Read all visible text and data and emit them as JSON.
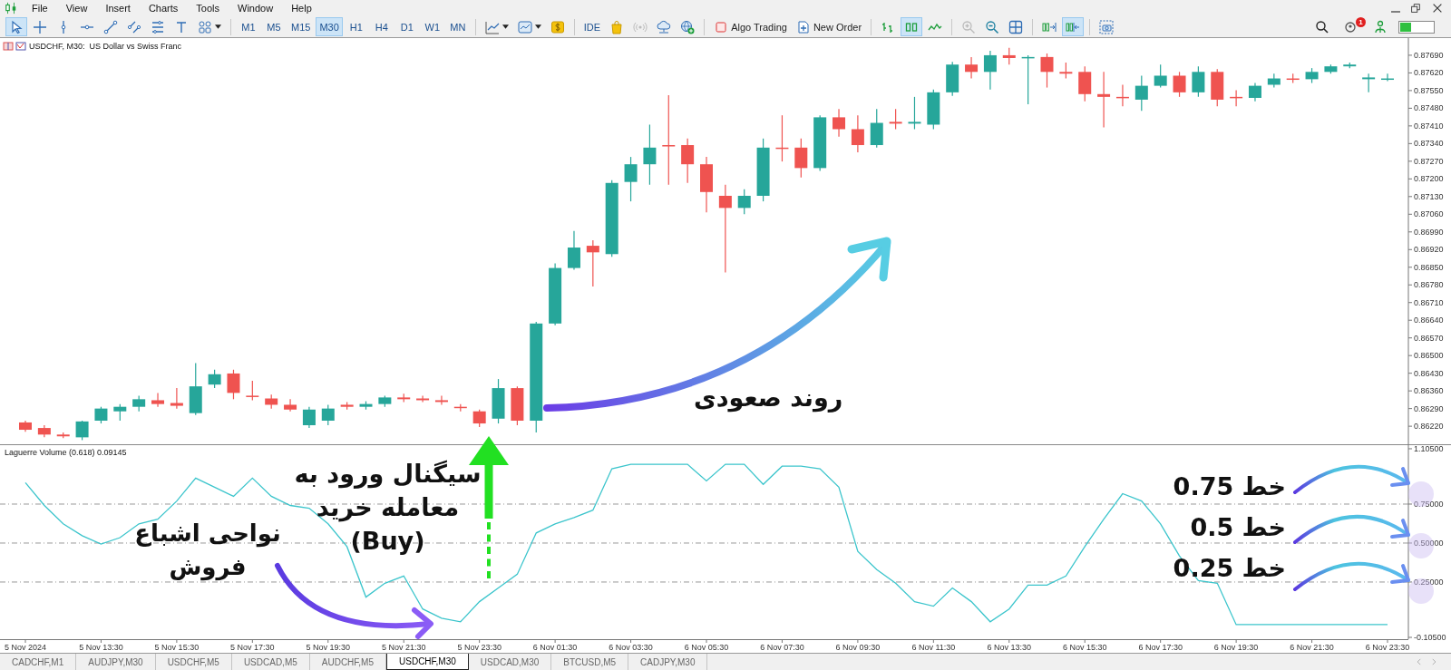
{
  "menu_bar": {
    "items": [
      "File",
      "View",
      "Insert",
      "Charts",
      "Tools",
      "Window",
      "Help"
    ]
  },
  "toolbar": {
    "drawing_tools": [
      {
        "kind": "cursor",
        "selected": true
      },
      {
        "kind": "crosshair",
        "selected": false
      },
      {
        "kind": "vertical-line",
        "selected": false
      },
      {
        "kind": "horizontal-line",
        "selected": false
      },
      {
        "kind": "trend-line",
        "selected": false
      },
      {
        "kind": "channel",
        "selected": false
      },
      {
        "kind": "fibonacci",
        "selected": false
      },
      {
        "kind": "text",
        "selected": false
      },
      {
        "kind": "shapes",
        "selected": false
      }
    ],
    "timeframes": [
      {
        "label": "M1",
        "selected": false
      },
      {
        "label": "M5",
        "selected": false
      },
      {
        "label": "M15",
        "selected": false
      },
      {
        "label": "M30",
        "selected": true
      },
      {
        "label": "H1",
        "selected": false
      },
      {
        "label": "H4",
        "selected": false
      },
      {
        "label": "D1",
        "selected": false
      },
      {
        "label": "W1",
        "selected": false
      },
      {
        "label": "MN",
        "selected": false
      }
    ],
    "ide_button": "IDE",
    "algo_trading_button": "Algo Trading",
    "new_order_button": "New Order",
    "chart_types": [
      {
        "kind": "bars",
        "selected": false
      },
      {
        "kind": "candles",
        "selected": true
      },
      {
        "kind": "line",
        "selected": false
      }
    ],
    "zoom_in": {
      "disabled": true
    },
    "scroll_tools": [
      {
        "kind": "autoscroll",
        "selected": false
      },
      {
        "kind": "chart-shift",
        "selected": true
      }
    ],
    "notification_count": "1"
  },
  "price_chart": {
    "chart_data": {
      "type": "candlestick",
      "title": "USDCHF, M30:  US Dollar vs Swiss Franc",
      "ylim": [
        0.86145,
        0.87758
      ],
      "yticks": [
        {
          "value": 0.8769,
          "label": "0.87690"
        },
        {
          "value": 0.8762,
          "label": "0.87620"
        },
        {
          "value": 0.8755,
          "label": "0.87550"
        },
        {
          "value": 0.8748,
          "label": "0.87480"
        },
        {
          "value": 0.8741,
          "label": "0.87410"
        },
        {
          "value": 0.8734,
          "label": "0.87340"
        },
        {
          "value": 0.8727,
          "label": "0.87270"
        },
        {
          "value": 0.872,
          "label": "0.87200"
        },
        {
          "value": 0.8713,
          "label": "0.87130"
        },
        {
          "value": 0.8706,
          "label": "0.87060"
        },
        {
          "value": 0.8699,
          "label": "0.86990"
        },
        {
          "value": 0.8692,
          "label": "0.86920"
        },
        {
          "value": 0.8685,
          "label": "0.86850"
        },
        {
          "value": 0.8678,
          "label": "0.86780"
        },
        {
          "value": 0.8671,
          "label": "0.86710"
        },
        {
          "value": 0.8664,
          "label": "0.86640"
        },
        {
          "value": 0.8657,
          "label": "0.86570"
        },
        {
          "value": 0.865,
          "label": "0.86500"
        },
        {
          "value": 0.8643,
          "label": "0.86430"
        },
        {
          "value": 0.8636,
          "label": "0.86360"
        },
        {
          "value": 0.8629,
          "label": "0.86290"
        },
        {
          "value": 0.8622,
          "label": "0.86220"
        }
      ],
      "ohlc": [
        [
          0.86235,
          0.86242,
          0.86198,
          0.86206
        ],
        [
          0.86213,
          0.86224,
          0.86176,
          0.86187
        ],
        [
          0.86187,
          0.86195,
          0.86173,
          0.8618
        ],
        [
          0.86176,
          0.86242,
          0.86165,
          0.86239
        ],
        [
          0.86242,
          0.86297,
          0.86231,
          0.8629
        ],
        [
          0.86279,
          0.86308,
          0.86242,
          0.86297
        ],
        [
          0.86297,
          0.86341,
          0.86279,
          0.86327
        ],
        [
          0.86323,
          0.86352,
          0.86297,
          0.86308
        ],
        [
          0.86312,
          0.86371,
          0.8629,
          0.86301
        ],
        [
          0.86272,
          0.8647,
          0.86264,
          0.86378
        ],
        [
          0.86385,
          0.86444,
          0.86371,
          0.86426
        ],
        [
          0.86429,
          0.86444,
          0.86327,
          0.86352
        ],
        [
          0.86341,
          0.864,
          0.86323,
          0.86338
        ],
        [
          0.8633,
          0.86345,
          0.8629,
          0.86305
        ],
        [
          0.86305,
          0.86327,
          0.86279,
          0.86286
        ],
        [
          0.86224,
          0.86297,
          0.86213,
          0.86286
        ],
        [
          0.86242,
          0.86305,
          0.86224,
          0.8629
        ],
        [
          0.86305,
          0.86316,
          0.86286,
          0.86297
        ],
        [
          0.86297,
          0.86319,
          0.86286,
          0.86308
        ],
        [
          0.86308,
          0.86341,
          0.86297,
          0.86334
        ],
        [
          0.86334,
          0.86349,
          0.86316,
          0.86327
        ],
        [
          0.8633,
          0.86341,
          0.86316,
          0.86323
        ],
        [
          0.86323,
          0.86341,
          0.86305,
          0.86316
        ],
        [
          0.86297,
          0.86308,
          0.86279,
          0.86294
        ],
        [
          0.86279,
          0.86286,
          0.86217,
          0.86231
        ],
        [
          0.8625,
          0.86407,
          0.86231,
          0.86371
        ],
        [
          0.86371,
          0.86378,
          0.86224,
          0.86242
        ],
        [
          0.86242,
          0.86634,
          0.86195,
          0.86627
        ],
        [
          0.86627,
          0.86865,
          0.8662,
          0.86847
        ],
        [
          0.86847,
          0.86994,
          0.8684,
          0.86928
        ],
        [
          0.86935,
          0.86957,
          0.86774,
          0.86909
        ],
        [
          0.86902,
          0.87195,
          0.86891,
          0.87184
        ],
        [
          0.87188,
          0.87287,
          0.87111,
          0.87258
        ],
        [
          0.87258,
          0.87415,
          0.87177,
          0.87324
        ],
        [
          0.87334,
          0.87532,
          0.87177,
          0.87331
        ],
        [
          0.87334,
          0.8736,
          0.87184,
          0.87258
        ],
        [
          0.87258,
          0.87287,
          0.87067,
          0.87148
        ],
        [
          0.87133,
          0.87177,
          0.86829,
          0.87085
        ],
        [
          0.87085,
          0.87159,
          0.8706,
          0.87133
        ],
        [
          0.87133,
          0.8736,
          0.87111,
          0.87324
        ],
        [
          0.87324,
          0.87452,
          0.87269,
          0.8732
        ],
        [
          0.87324,
          0.8736,
          0.87206,
          0.87243
        ],
        [
          0.87243,
          0.87452,
          0.87232,
          0.87444
        ],
        [
          0.87444,
          0.87477,
          0.87367,
          0.87397
        ],
        [
          0.87397,
          0.87452,
          0.87305,
          0.87334
        ],
        [
          0.87334,
          0.87477,
          0.87324,
          0.87422
        ],
        [
          0.87426,
          0.87477,
          0.87397,
          0.87419
        ],
        [
          0.87419,
          0.87525,
          0.87397,
          0.87426
        ],
        [
          0.87415,
          0.87554,
          0.87397,
          0.87543
        ],
        [
          0.87543,
          0.87664,
          0.87529,
          0.87653
        ],
        [
          0.87653,
          0.87683,
          0.87598,
          0.87624
        ],
        [
          0.87624,
          0.87708,
          0.87554,
          0.8769
        ],
        [
          0.8769,
          0.87719,
          0.87653,
          0.87679
        ],
        [
          0.87679,
          0.8769,
          0.87496,
          0.87683
        ],
        [
          0.87683,
          0.87697,
          0.87562,
          0.87624
        ],
        [
          0.87624,
          0.87661,
          0.87598,
          0.87617
        ],
        [
          0.87624,
          0.87646,
          0.87507,
          0.87536
        ],
        [
          0.87536,
          0.87624,
          0.87404,
          0.87525
        ],
        [
          0.87525,
          0.87573,
          0.87488,
          0.87521
        ],
        [
          0.87514,
          0.87609,
          0.8747,
          0.87569
        ],
        [
          0.87569,
          0.87653,
          0.87562,
          0.87609
        ],
        [
          0.87609,
          0.87624,
          0.87525,
          0.87543
        ],
        [
          0.87543,
          0.87646,
          0.87525,
          0.87624
        ],
        [
          0.87624,
          0.87635,
          0.87488,
          0.87514
        ],
        [
          0.87525,
          0.87551,
          0.87488,
          0.87521
        ],
        [
          0.87521,
          0.8758,
          0.87507,
          0.87569
        ],
        [
          0.87573,
          0.87617,
          0.87562,
          0.87598
        ],
        [
          0.87598,
          0.87617,
          0.8758,
          0.87595
        ],
        [
          0.87595,
          0.87639,
          0.8758,
          0.87624
        ],
        [
          0.87624,
          0.87653,
          0.87617,
          0.87646
        ],
        [
          0.87646,
          0.87661,
          0.87639,
          0.87653
        ],
        [
          0.87595,
          0.87617,
          0.87543,
          0.87602
        ],
        [
          0.87595,
          0.87617,
          0.87587,
          0.87598
        ]
      ]
    }
  },
  "indicator_chart": {
    "chart_data": {
      "type": "line",
      "title": "Laguerre Volume (0.618) 0.09145",
      "ylim": [
        -0.1166,
        1.128
      ],
      "grid": true,
      "yticks": [
        {
          "value": 1.105,
          "label": "1.10500"
        },
        {
          "value": 0.75,
          "label": "0.75000"
        },
        {
          "value": 0.5,
          "label": "0.50000"
        },
        {
          "value": 0.25,
          "label": "0.25000"
        },
        {
          "value": -0.105,
          "label": "-0.10500"
        }
      ],
      "categories": [
        "5 Nov 2024",
        null,
        null,
        null,
        "5 Nov 13:30",
        null,
        null,
        null,
        "5 Nov 15:30",
        null,
        null,
        null,
        "5 Nov 17:30",
        null,
        null,
        null,
        "5 Nov 19:30",
        null,
        null,
        null,
        "5 Nov 21:30",
        null,
        null,
        null,
        "5 Nov 23:30",
        null,
        null,
        null,
        "6 Nov 01:30",
        null,
        null,
        null,
        "6 Nov 03:30",
        null,
        null,
        null,
        "6 Nov 05:30",
        null,
        null,
        null,
        "6 Nov 07:30",
        null,
        null,
        null,
        "6 Nov 09:30",
        null,
        null,
        null,
        "6 Nov 11:30",
        null,
        null,
        null,
        "6 Nov 13:30",
        null,
        null,
        null,
        "6 Nov 15:30",
        null,
        null,
        null,
        "6 Nov 17:30",
        null,
        null,
        null,
        "6 Nov 19:30",
        null,
        null,
        null,
        "6 Nov 21:30",
        null,
        null,
        null,
        "6 Nov 23:30"
      ],
      "series": [
        {
          "color": "#3cc5cc",
          "values": [
            0.888,
            0.741,
            0.623,
            0.547,
            0.494,
            0.535,
            0.623,
            0.653,
            0.77,
            0.917,
            0.858,
            0.8,
            0.917,
            0.8,
            0.741,
            0.723,
            0.623,
            0.477,
            0.153,
            0.242,
            0.289,
            0.077,
            0.018,
            -0.005,
            0.124,
            0.212,
            0.3,
            0.565,
            0.623,
            0.664,
            0.711,
            0.976,
            1.005,
            1.005,
            1.005,
            1.005,
            0.899,
            1.005,
            1.005,
            0.876,
            0.993,
            0.993,
            0.976,
            0.858,
            0.447,
            0.33,
            0.242,
            0.124,
            0.095,
            0.212,
            0.124,
            -0.005,
            0.077,
            0.23,
            0.23,
            0.289,
            0.477,
            0.653,
            0.817,
            0.77,
            0.623,
            0.418,
            0.259,
            0.242,
            -0.023,
            -0.023,
            -0.023,
            -0.023,
            -0.023,
            -0.023,
            -0.023,
            -0.023,
            -0.023
          ]
        }
      ]
    }
  },
  "annotations": {
    "uptrend": "روند صعودی",
    "buy_signal": [
      "سیگنال ورود به",
      "معامله خرید",
      "(Buy)"
    ],
    "oversold": [
      "نواحی اشباع",
      "فروش"
    ],
    "levels": [
      "خط 0.75",
      "خط 0.5",
      "خط 0.25"
    ]
  },
  "tabs": [
    {
      "label": "CADCHF,M1",
      "selected": false
    },
    {
      "label": "AUDJPY,M30",
      "selected": false
    },
    {
      "label": "USDCHF,M5",
      "selected": false
    },
    {
      "label": "USDCAD,M5",
      "selected": false
    },
    {
      "label": "AUDCHF,M5",
      "selected": false
    },
    {
      "label": "USDCHF,M30",
      "selected": true
    },
    {
      "label": "USDCAD,M30",
      "selected": false
    },
    {
      "label": "BTCUSD,M5",
      "selected": false
    },
    {
      "label": "CADJPY,M30",
      "selected": false
    }
  ]
}
